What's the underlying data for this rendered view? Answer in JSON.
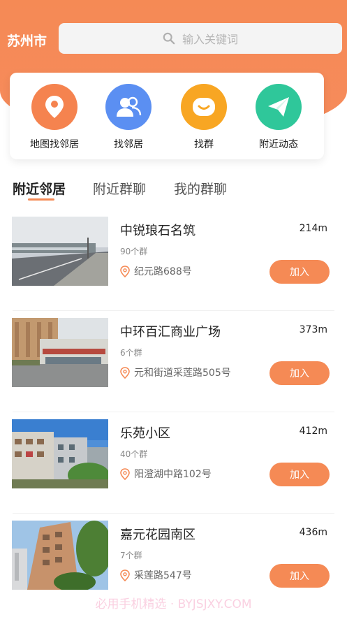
{
  "header": {
    "city": "苏州市",
    "search_placeholder": "输入关键词"
  },
  "quick_actions": [
    {
      "label": "地图找邻居",
      "icon": "location-pin-icon",
      "color": "#f5834f"
    },
    {
      "label": "找邻居",
      "icon": "people-icon",
      "color": "#5b8ff2"
    },
    {
      "label": "找群",
      "icon": "smile-icon",
      "color": "#f8a623"
    },
    {
      "label": "附近动态",
      "icon": "paper-plane-icon",
      "color": "#2fc79a"
    }
  ],
  "tabs": [
    {
      "label": "附近邻居",
      "active": true
    },
    {
      "label": "附近群聊",
      "active": false
    },
    {
      "label": "我的群聊",
      "active": false
    }
  ],
  "list": [
    {
      "name": "中锐琅石名筑",
      "distance": "214m",
      "groups": "90个群",
      "address": "纪元路688号",
      "action": "加入"
    },
    {
      "name": "中环百汇商业广场",
      "distance": "373m",
      "groups": "6个群",
      "address": "元和街道采莲路505号",
      "action": "加入"
    },
    {
      "name": "乐苑小区",
      "distance": "412m",
      "groups": "40个群",
      "address": "阳澄湖中路102号",
      "action": "加入"
    },
    {
      "name": "嘉元花园南区",
      "distance": "436m",
      "groups": "7个群",
      "address": "采莲路547号",
      "action": "加入"
    }
  ],
  "watermark": "必用手机精选 · BYJSJXY.COM"
}
